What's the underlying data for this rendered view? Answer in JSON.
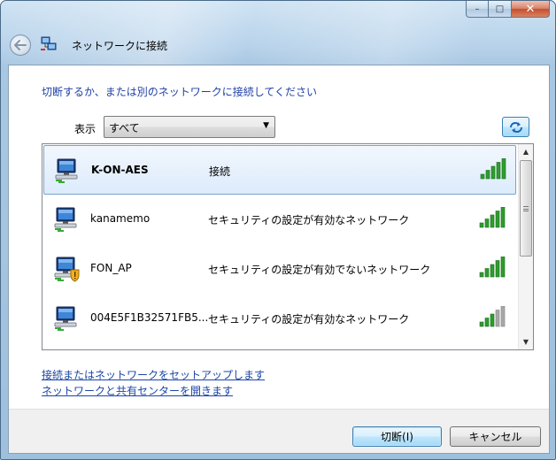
{
  "window": {
    "title": "ネットワークに接続",
    "caption_buttons": {
      "minimize": "–",
      "maximize": "□",
      "close": "✕"
    }
  },
  "instruction": "切断するか、または別のネットワークに接続してください",
  "filter": {
    "label": "表示",
    "selected": "すべて"
  },
  "networks": [
    {
      "name": "K-ON-AES",
      "status": "接続",
      "selected": true,
      "warning": false,
      "signal_bars": 5,
      "signal_strength": 5
    },
    {
      "name": "kanamemo",
      "status": "セキュリティの設定が有効なネットワーク",
      "selected": false,
      "warning": false,
      "signal_bars": 5,
      "signal_strength": 5
    },
    {
      "name": "FON_AP",
      "status": "セキュリティの設定が有効でないネットワーク",
      "selected": false,
      "warning": true,
      "signal_bars": 5,
      "signal_strength": 5
    },
    {
      "name": "004E5F1B32571FB5...",
      "status": "セキュリティの設定が有効なネットワーク",
      "selected": false,
      "warning": false,
      "signal_bars": 5,
      "signal_strength": 3
    }
  ],
  "links": {
    "setup": "接続またはネットワークをセットアップします",
    "sharing_center": "ネットワークと共有センターを開きます"
  },
  "buttons": {
    "disconnect": "切断(I)",
    "cancel": "キャンセル"
  },
  "colors": {
    "link": "#1b46a8",
    "instruction": "#1e3fa5",
    "signal_green": "#2e9d2e",
    "signal_gray": "#a8a8a8"
  },
  "icons": {
    "back": "back-arrow-icon",
    "title": "network-connection-icon",
    "refresh": "refresh-icon",
    "network": "wireless-network-icon",
    "warning": "security-warning-shield-icon",
    "signal": "signal-strength-icon"
  }
}
